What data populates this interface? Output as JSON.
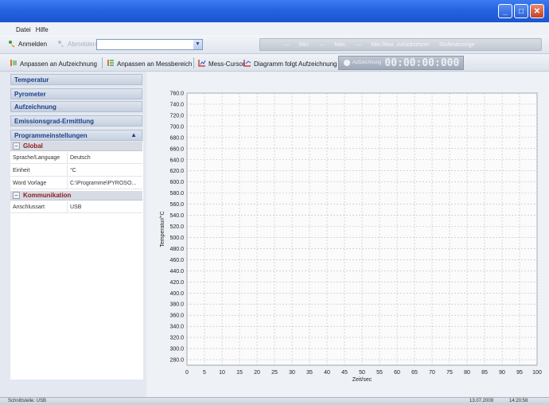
{
  "window": {
    "buttons": {
      "minimize": "_",
      "maximize": "□",
      "close": "✕"
    }
  },
  "menu": {
    "items": [
      "Datei",
      "Hilfe"
    ]
  },
  "toolbar": {
    "login": "Anmelden",
    "logout": "Abmelden",
    "combo_value": "",
    "disabled": [
      "Min.",
      "Max.",
      "Min./Max. zurücksetzen",
      "Stufenanzeige"
    ]
  },
  "toolbar2": {
    "fit_recording": "Anpassen an Aufzeichnung",
    "fit_range": "Anpassen an Messbereich",
    "cursor": "Mess-Cursor",
    "follow": "Diagramm folgt Aufzeichnung",
    "timer_label": "Aufzeichnung",
    "timer_value": "00:00:00:000"
  },
  "sidebar": {
    "sections": [
      "Temperatur",
      "Pyrometer",
      "Aufzeichnung",
      "Emissionsgrad-Ermittlung",
      "Programmeinstellungen"
    ],
    "groups": {
      "global": {
        "label": "Global",
        "rows": [
          {
            "k": "Sprache/Language",
            "v": "Deutsch"
          },
          {
            "k": "Einheit",
            "v": "°C"
          },
          {
            "k": "Word Vorlage",
            "v": "C:\\Programme\\PYROSO..."
          }
        ]
      },
      "comm": {
        "label": "Kommunikation",
        "rows": [
          {
            "k": "Anschlussart",
            "v": "USB"
          }
        ]
      }
    }
  },
  "status": {
    "left": "Schnittstelle: USB",
    "date": "13.07.2009",
    "time": "14:20:58"
  },
  "chart_data": {
    "type": "line",
    "ylabel": "Temperatur/°C",
    "xlabel": "Zeit/sec",
    "ylim": [
      270,
      760
    ],
    "xlim": [
      0,
      100
    ],
    "yticks": [
      280,
      300,
      320,
      340,
      360,
      380,
      400,
      420,
      440,
      460,
      480,
      500,
      520,
      540,
      560,
      580,
      600,
      620,
      640,
      660,
      680,
      700,
      720,
      740,
      760
    ],
    "ytick_labels": [
      "280.0",
      "300.0",
      "320.0",
      "340.0",
      "360.0",
      "380.0",
      "400.0",
      "420.0",
      "440.0",
      "460.0",
      "480.0",
      "500.0",
      "520.0",
      "540.0",
      "560.0",
      "580.0",
      "600.0",
      "620.0",
      "640.0",
      "660.0",
      "680.0",
      "700.0",
      "720.0",
      "740.0",
      "760.0"
    ],
    "xticks": [
      0,
      5,
      10,
      15,
      20,
      25,
      30,
      35,
      40,
      45,
      50,
      55,
      60,
      65,
      70,
      75,
      80,
      85,
      90,
      95,
      100
    ],
    "xtick_labels": [
      "0",
      "5",
      "10",
      "15",
      "20",
      "25",
      "30",
      "35",
      "40",
      "45",
      "50",
      "55",
      "60",
      "65",
      "70",
      "75",
      "80",
      "85",
      "90",
      "95",
      "100"
    ],
    "series": [],
    "grid": true
  }
}
